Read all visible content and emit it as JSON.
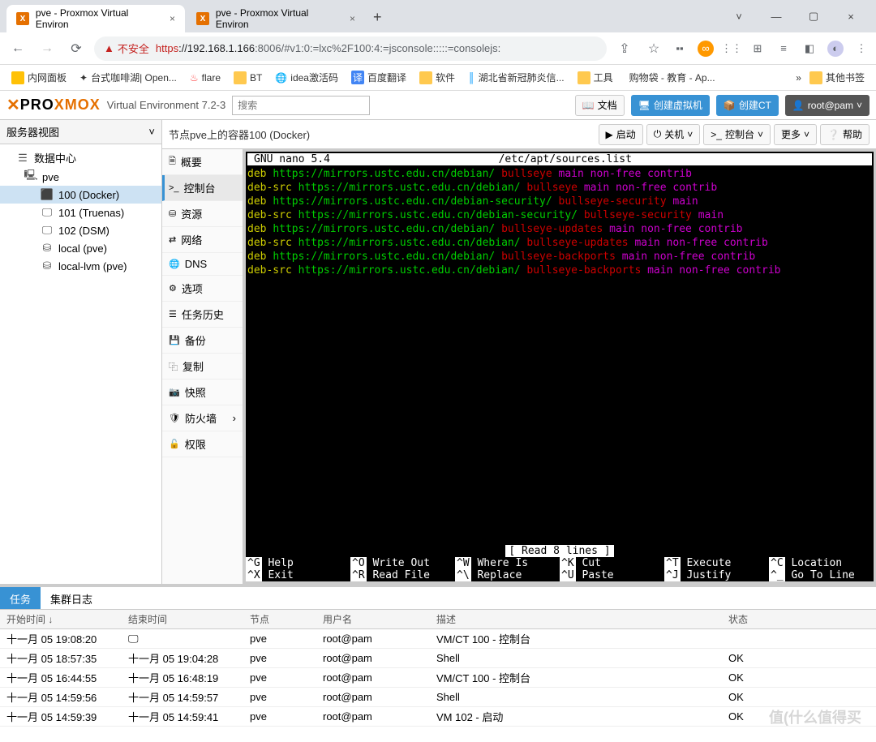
{
  "browser": {
    "tab1": "pve - Proxmox Virtual Environ",
    "tab2": "pve - Proxmox Virtual Environ",
    "url_insecure": "不安全",
    "url_https": "https",
    "url_host": "://192.168.1.166",
    "url_path": ":8006/#v1:0:=lxc%2F100:4:=jsconsole:::::=consolejs:"
  },
  "bookmarks": {
    "b0": "内网面板",
    "b1": "台式咖啡湖| Open...",
    "b2": "flare",
    "b3": "BT",
    "b4": "idea激活码",
    "b5": "百度翻译",
    "b6": "软件",
    "b7": "湖北省新冠肺炎信...",
    "b8": "工具",
    "b9": "购物袋 - 教育 - Ap...",
    "b10": "其他书签"
  },
  "header": {
    "env": "Virtual Environment 7.2-3",
    "search_ph": "搜索",
    "docs": "文档",
    "create_vm": "创建虚拟机",
    "create_ct": "创建CT",
    "user": "root@pam"
  },
  "tree": {
    "view": "服务器视图",
    "dc": "数据中心",
    "pve": "pve",
    "ct100": "100 (Docker)",
    "ct101": "101 (Truenas)",
    "ct102": "102 (DSM)",
    "local": "local (pve)",
    "lvm": "local-lvm (pve)"
  },
  "content": {
    "title": "节点pve上的容器100 (Docker)",
    "start": "启动",
    "shutdown": "关机",
    "console": "控制台",
    "more": "更多",
    "help": "帮助"
  },
  "sidemenu": {
    "summary": "概要",
    "console": "控制台",
    "resources": "资源",
    "network": "网络",
    "dns": "DNS",
    "options": "选项",
    "tasks": "任务历史",
    "backup": "备份",
    "replication": "复制",
    "snapshot": "快照",
    "firewall": "防火墙",
    "perm": "权限"
  },
  "nano": {
    "title_left": "GNU nano 5.4",
    "title_right": "/etc/apt/sources.list",
    "status": "[ Read 8 lines ]",
    "l1_t": "deb ",
    "l1_u": "https://mirrors.ustc.edu.cn/debian/ ",
    "l1_r": "bullseye ",
    "l1_c": "main non-free contrib",
    "l2_t": "deb-src ",
    "l2_u": "https://mirrors.ustc.edu.cn/debian/ ",
    "l2_r": "bullseye ",
    "l2_c": "main non-free contrib",
    "l3_t": "deb ",
    "l3_u": "https://mirrors.ustc.edu.cn/debian-security/ ",
    "l3_r": "bullseye-security ",
    "l3_c": "main",
    "l4_t": "deb-src ",
    "l4_u": "https://mirrors.ustc.edu.cn/debian-security/ ",
    "l4_r": "bullseye-security ",
    "l4_c": "main",
    "l5_t": "deb ",
    "l5_u": "https://mirrors.ustc.edu.cn/debian/ ",
    "l5_r": "bullseye-updates ",
    "l5_c": "main non-free contrib",
    "l6_t": "deb-src ",
    "l6_u": "https://mirrors.ustc.edu.cn/debian/ ",
    "l6_r": "bullseye-updates ",
    "l6_c": "main non-free contrib",
    "l7_t": "deb ",
    "l7_u": "https://mirrors.ustc.edu.cn/debian/ ",
    "l7_r": "bullseye-backports ",
    "l7_c": "main non-free contrib",
    "l8_t": "deb-src ",
    "l8_u": "https://mirrors.ustc.edu.cn/debian/ ",
    "l8_r": "bullseye-backports ",
    "l8_c": "main non-free contrib",
    "k_help": "Help",
    "k_exit": "Exit",
    "k_write": "Write Out",
    "k_read": "Read File",
    "k_where": "Where Is",
    "k_repl": "Replace",
    "k_cut": "Cut",
    "k_paste": "Paste",
    "k_exec": "Execute",
    "k_just": "Justify",
    "k_loc": "Location",
    "k_goto": "Go To Line"
  },
  "bottom": {
    "tasks": "任务",
    "cluster": "集群日志",
    "col_start": "开始时间 ↓",
    "col_end": "结束时间",
    "col_node": "节点",
    "col_user": "用户名",
    "col_desc": "描述",
    "col_stat": "状态"
  },
  "rows": [
    {
      "s": "十一月 05 19:08:20",
      "e": "",
      "n": "pve",
      "u": "root@pam",
      "d": "VM/CT 100 - 控制台",
      "st": ""
    },
    {
      "s": "十一月 05 18:57:35",
      "e": "十一月 05 19:04:28",
      "n": "pve",
      "u": "root@pam",
      "d": "Shell",
      "st": "OK"
    },
    {
      "s": "十一月 05 16:44:55",
      "e": "十一月 05 16:48:19",
      "n": "pve",
      "u": "root@pam",
      "d": "VM/CT 100 - 控制台",
      "st": "OK"
    },
    {
      "s": "十一月 05 14:59:56",
      "e": "十一月 05 14:59:57",
      "n": "pve",
      "u": "root@pam",
      "d": "Shell",
      "st": "OK"
    },
    {
      "s": "十一月 05 14:59:39",
      "e": "十一月 05 14:59:41",
      "n": "pve",
      "u": "root@pam",
      "d": "VM 102 - 启动",
      "st": "OK"
    }
  ],
  "watermark": "值(什么值得买"
}
